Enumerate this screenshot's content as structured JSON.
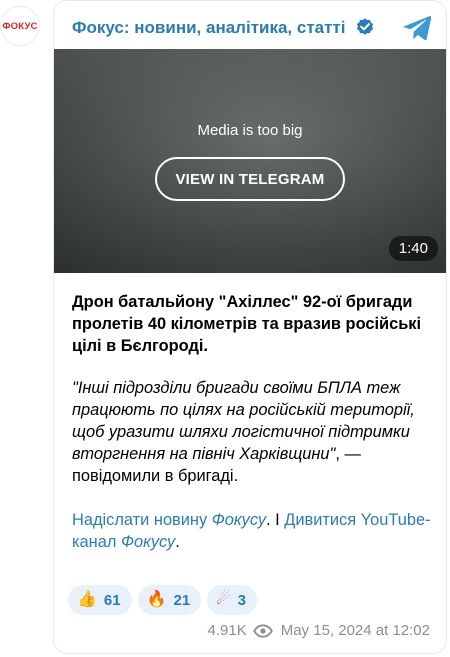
{
  "avatar": {
    "logo_text": "ФОКУС"
  },
  "header": {
    "channel_name": "Фокус: новини, аналітика, статті",
    "verified_icon": "verified-badge-icon",
    "telegram_icon": "telegram-plane-icon"
  },
  "media": {
    "message": "Media is too big",
    "button_label": "VIEW IN TELEGRAM",
    "duration": "1:40"
  },
  "post": {
    "headline": "Дрон батальйону \"Ахіллес\" 92-ої бригади пролетів 40 кілометрів та вразив російські цілі в Бєлгороді.",
    "quote_italic": "\"Інші підрозділи бригади своїми БПЛА теж працюють по цілях на російській території, щоб уразити шляхи логістичної підтримки вторгнення на північ Харківщини\"",
    "quote_tail": ", — повідомили в бригаді.",
    "link1_text": "Надіслати новину ",
    "link1_name": "Фокусу",
    "separator": ". І ",
    "link2_text": "Дивитися YouTube-канал ",
    "link2_name": "Фокусу",
    "end": "."
  },
  "reactions": [
    {
      "emoji": "👍",
      "icon": "thumbs-up-icon",
      "count": "61"
    },
    {
      "emoji": "🔥",
      "icon": "fire-icon",
      "count": "21"
    },
    {
      "emoji": "☄",
      "icon": "comet-icon",
      "count": "3"
    }
  ],
  "meta": {
    "views": "4.91K",
    "date": "May 15, 2024 at 12:02"
  },
  "colors": {
    "link": "#2a7cb9",
    "logo_red": "#e3231f",
    "reaction_bg": "#e8f1f9",
    "meta_gray": "#8a8f95"
  }
}
